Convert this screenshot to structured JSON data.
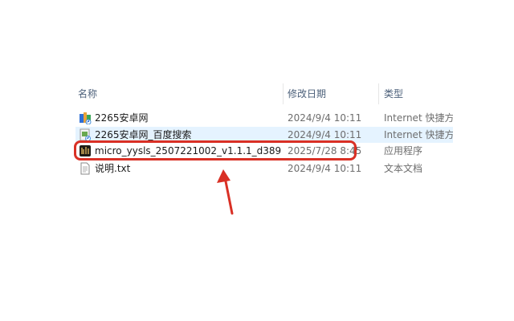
{
  "columns": {
    "name": "名称",
    "date": "修改日期",
    "type": "类型"
  },
  "files": [
    {
      "name": "2265安卓网",
      "date": "2024/9/4 10:11",
      "type": "Internet 快捷方式",
      "icon": "internet-shortcut-icon"
    },
    {
      "name": "2265安卓网_百度搜索",
      "date": "2024/9/4 10:11",
      "type": "Internet 快捷方式",
      "icon": "internet-shortcut-icon"
    },
    {
      "name": "micro_yysls_2507221002_v1.1.1_d389...",
      "date": "2025/7/28 8:45",
      "type": "应用程序",
      "icon": "application-icon"
    },
    {
      "name": "说明.txt",
      "date": "2024/9/4 10:11",
      "type": "文本文档",
      "icon": "text-document-icon"
    }
  ],
  "colors": {
    "annotation": "#d93025",
    "hover_row": "#e5f3ff"
  }
}
